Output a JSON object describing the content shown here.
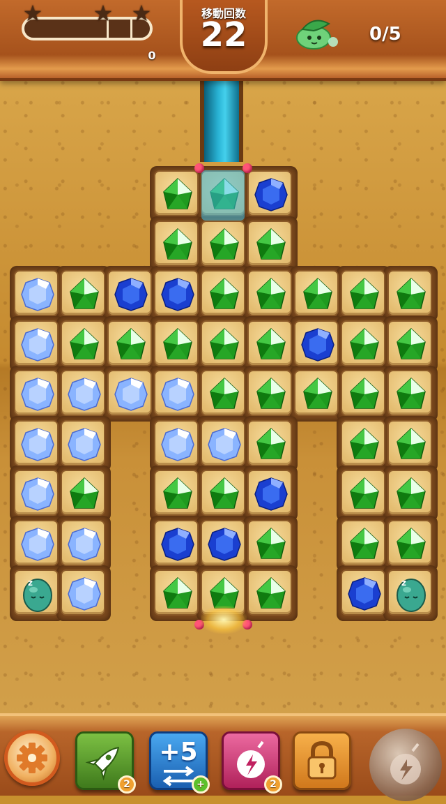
{
  "header": {
    "score": "0",
    "moves_label": "移動回数",
    "moves_value": "22",
    "goal_count": "0/5",
    "goal_creature_icon": "green-leaf-creature-icon",
    "stars": 3
  },
  "board": {
    "rows": [
      [
        null,
        null,
        null,
        "G",
        "G",
        "B",
        null,
        null,
        null
      ],
      [
        null,
        null,
        null,
        "G",
        "G",
        "G",
        null,
        null,
        null
      ],
      [
        "L",
        "G",
        "B",
        "B",
        "G",
        "G",
        "G",
        "G",
        "G"
      ],
      [
        "L",
        "G",
        "G",
        "G",
        "G",
        "G",
        "B",
        "G",
        "G"
      ],
      [
        "L",
        "L",
        "L",
        "L",
        "G",
        "G",
        "G",
        "G",
        "G"
      ],
      [
        "L",
        "L",
        null,
        "L",
        "L",
        "G",
        null,
        "G",
        "G"
      ],
      [
        "L",
        "G",
        null,
        "G",
        "G",
        "B",
        null,
        "G",
        "G"
      ],
      [
        "L",
        "L",
        null,
        "B",
        "B",
        "G",
        null,
        "G",
        "G"
      ],
      [
        "E",
        "L",
        null,
        "G",
        "G",
        "G",
        null,
        "B",
        "E"
      ]
    ],
    "legend": {
      "G": "green-gem",
      "B": "blue-gem",
      "L": "light-blue-gem",
      "E": "sleeping-egg"
    }
  },
  "footer": {
    "boosters": [
      {
        "name": "rocket",
        "count": "2",
        "color": "#5e9a2a"
      },
      {
        "name": "plus5",
        "label": "+5",
        "count": "+",
        "color": "#2a7fd0"
      },
      {
        "name": "lightning-bomb",
        "count": "2",
        "color": "#d03a78"
      },
      {
        "name": "locked",
        "color": "#e08a28"
      }
    ]
  }
}
